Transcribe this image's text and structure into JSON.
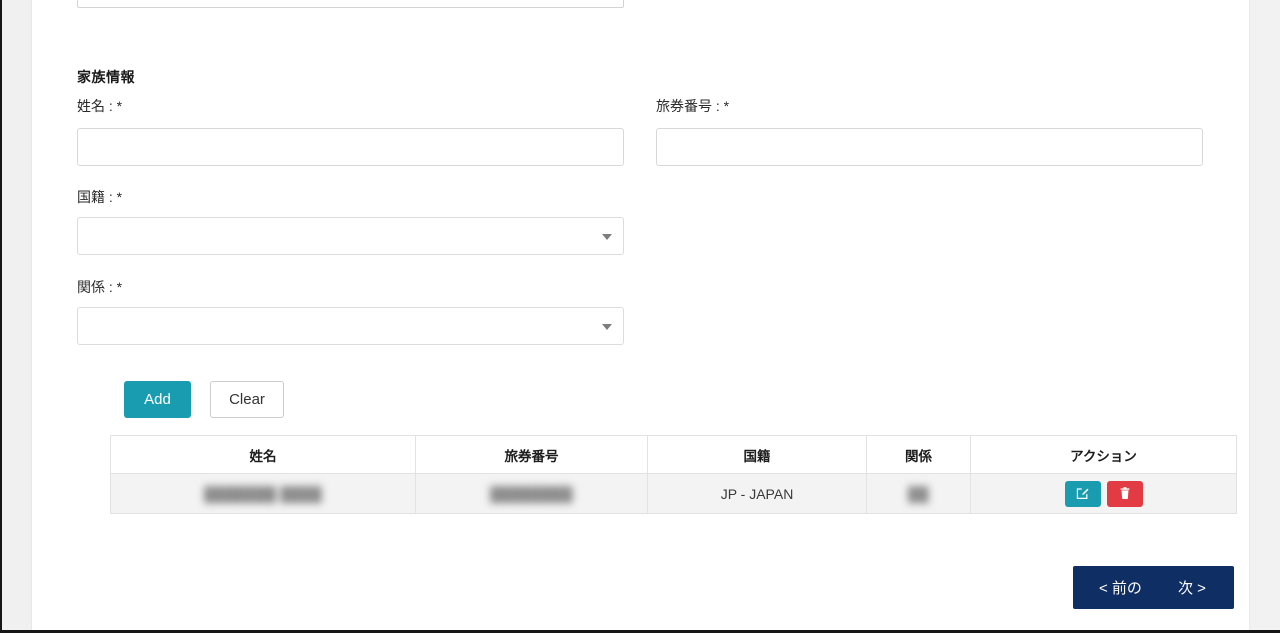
{
  "section": {
    "title": "家族情報"
  },
  "form": {
    "name": {
      "label": "姓名 : *",
      "value": "",
      "placeholder": ""
    },
    "passport": {
      "label": "旅券番号 : *",
      "value": "",
      "placeholder": ""
    },
    "nationality": {
      "label": "国籍 : *",
      "selected": "",
      "caret_icon": "chevron-down-icon"
    },
    "relationship": {
      "label": "関係 : *",
      "selected": "",
      "caret_icon": "chevron-down-icon"
    },
    "buttons": {
      "add": "Add",
      "clear": "Clear"
    }
  },
  "table": {
    "columns": [
      "姓名",
      "旅券番号",
      "国籍",
      "関係",
      "アクション"
    ],
    "rows": [
      {
        "name": "███████ ████",
        "name_redacted": true,
        "passport": "████████",
        "passport_redacted": true,
        "nationality": "JP - JAPAN",
        "relationship": "██",
        "relationship_redacted": true,
        "actions": {
          "edit_icon": "edit-pencil-icon",
          "delete_icon": "trash-icon"
        }
      }
    ]
  },
  "navigation": {
    "previous": "< 前の",
    "next": "次 >"
  },
  "colors": {
    "accent_teal": "#1a9cb0",
    "danger_red": "#e23b43",
    "nav_navy": "#0f2e63",
    "row_gray": "#f3f3f3",
    "border_gray": "#e2e2e2"
  }
}
